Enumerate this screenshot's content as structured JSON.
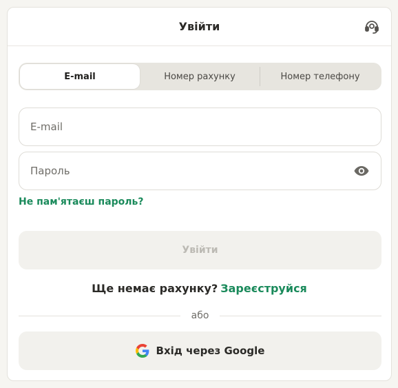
{
  "header": {
    "title": "Увійти",
    "support_icon": "headset-icon"
  },
  "tabs": [
    {
      "label": "E-mail",
      "active": true
    },
    {
      "label": "Номер рахунку",
      "active": false
    },
    {
      "label": "Номер телефону",
      "active": false
    }
  ],
  "form": {
    "email_placeholder": "E-mail",
    "email_value": "",
    "password_placeholder": "Пароль",
    "password_value": "",
    "password_toggle_icon": "eye-icon",
    "forgot_link": "Не пам'ятаєш пароль?",
    "submit_label": "Увійти"
  },
  "signup": {
    "text": "Ще немає рахунку?",
    "link": "Зареєструйся"
  },
  "divider": {
    "text": "або"
  },
  "google": {
    "label": "Вхід через Google",
    "icon": "google-icon"
  },
  "colors": {
    "accent": "#1a8a5b",
    "background": "#f6f5f1",
    "button_disabled_bg": "#f2f1ed"
  }
}
